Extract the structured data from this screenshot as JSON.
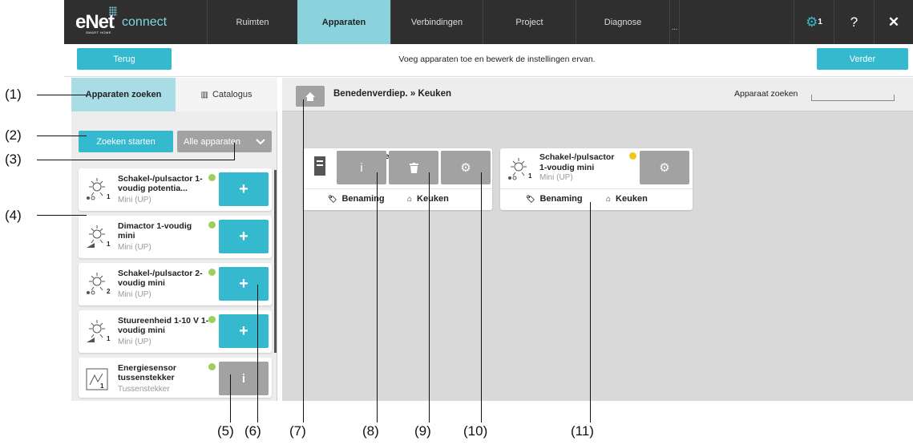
{
  "topnav": {
    "logo_text": "eNet",
    "logo_connect": "connect",
    "logo_sub": "SMART HOME",
    "tabs": [
      "Ruimten",
      "Apparaten",
      "Verbindingen",
      "Project",
      "Diagnose"
    ],
    "active_tab": "Apparaten",
    "more": "...",
    "settings_badge": "1",
    "help": "?",
    "close": "✕"
  },
  "subheader": {
    "back_label": "Terug",
    "instruction": "Voeg apparaten toe en bewerk de instellingen ervan.",
    "next_label": "Verder"
  },
  "left": {
    "tab_search": "Apparaten zoeken",
    "tab_catalog": "Catalogus",
    "start_search": "Zoeken starten",
    "filter": "Alle apparaten",
    "devices": [
      {
        "name": "Schakel-/pulsactor 1-voudig potentia...",
        "sub": "Mini (UP)",
        "num": "1",
        "action": "+"
      },
      {
        "name": "Dimactor 1-voudig mini",
        "sub": "Mini (UP)",
        "num": "1",
        "action": "+"
      },
      {
        "name": "Schakel-/pulsactor 2-voudig mini",
        "sub": "Mini (UP)",
        "num": "2",
        "action": "+"
      },
      {
        "name": "Stuureenheid 1-10 V 1-voudig mini",
        "sub": "Mini (UP)",
        "num": "1",
        "action": "+"
      },
      {
        "name": "Energiesensor tussenstekker",
        "sub": "Tussenstekker",
        "num": "1",
        "action": "i"
      }
    ]
  },
  "right": {
    "breadcrumb": "Benedenverdiep. » Keuken",
    "search_label": "Apparaat zoeken",
    "card1": {
      "title_fragment": "e",
      "name_label": "Benaming",
      "room_label": "Keuken",
      "info": "i"
    },
    "card2": {
      "line1": "Schakel-/pulsactor",
      "line2": "1-voudig mini",
      "sub": "Mini (UP)",
      "num": "1",
      "name_label": "Benaming",
      "room_label": "Keuken"
    }
  },
  "callouts": [
    "(1)",
    "(2)",
    "(3)",
    "(4)",
    "(5)",
    "(6)",
    "(7)",
    "(8)",
    "(9)",
    "(10)",
    "(11)"
  ],
  "colors": {
    "accent": "#34b9cf",
    "active_tab": "#8ad3dd",
    "status_green": "#9ccf5d",
    "status_yellow": "#f5c518",
    "grey_button": "#a2a2a2"
  }
}
